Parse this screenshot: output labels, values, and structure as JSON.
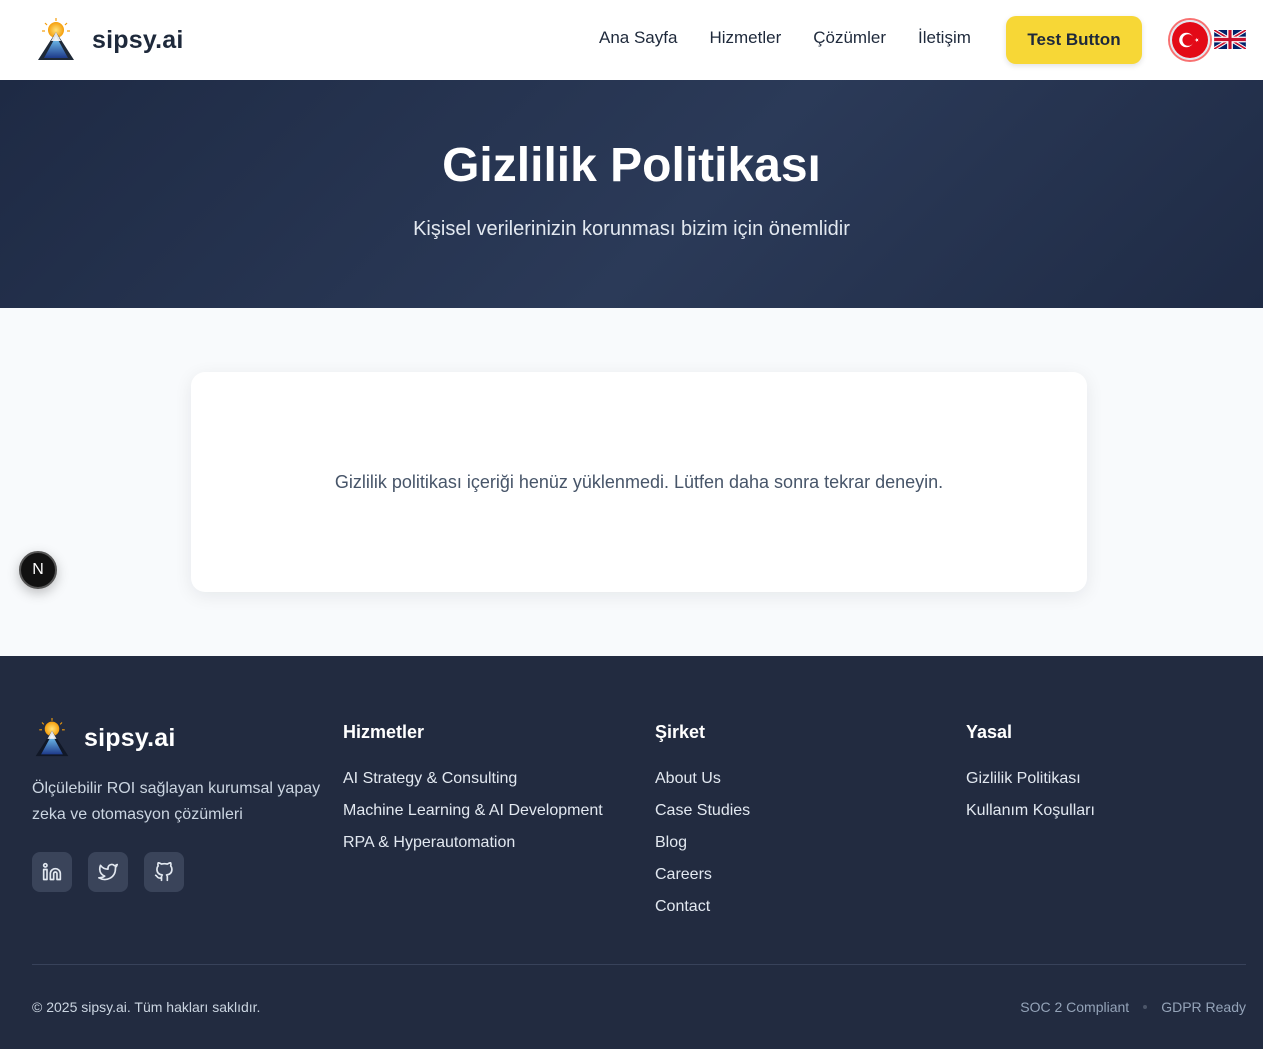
{
  "header": {
    "brand_name": "sipsy.ai",
    "nav": [
      "Ana Sayfa",
      "Hizmetler",
      "Çözümler",
      "İletişim"
    ],
    "cta_label": "Test Button",
    "languages": [
      {
        "code": "tr",
        "icon": "turkey-flag-icon",
        "active": true
      },
      {
        "code": "en",
        "icon": "uk-flag-icon",
        "active": false
      }
    ]
  },
  "hero": {
    "title": "Gizlilik Politikası",
    "subtitle": "Kişisel verilerinizin korunması bizim için önemlidir"
  },
  "content": {
    "message": "Gizlilik politikası içeriği henüz yüklenmedi. Lütfen daha sonra tekrar deneyin."
  },
  "dev_badge": {
    "label": "N"
  },
  "footer": {
    "brand_name": "sipsy.ai",
    "description": "Ölçülebilir ROI sağlayan kurumsal yapay zeka ve otomasyon çözümleri",
    "socials": [
      "linkedin-icon",
      "twitter-icon",
      "github-icon"
    ],
    "columns": [
      {
        "title": "Hizmetler",
        "links": [
          "AI Strategy & Consulting",
          "Machine Learning & AI Development",
          "RPA & Hyperautomation"
        ]
      },
      {
        "title": "Şirket",
        "links": [
          "About Us",
          "Case Studies",
          "Blog",
          "Careers",
          "Contact"
        ]
      },
      {
        "title": "Yasal",
        "links": [
          "Gizlilik Politikası",
          "Kullanım Koşulları"
        ]
      }
    ],
    "copyright": "© 2025 sipsy.ai. Tüm hakları saklıdır.",
    "badges": [
      "SOC 2 Compliant",
      "GDPR Ready"
    ]
  },
  "colors": {
    "accent": "#f7d736",
    "hero_bg": "#1e2a44",
    "footer_bg": "#222b40",
    "page_bg": "#f8fafc"
  }
}
